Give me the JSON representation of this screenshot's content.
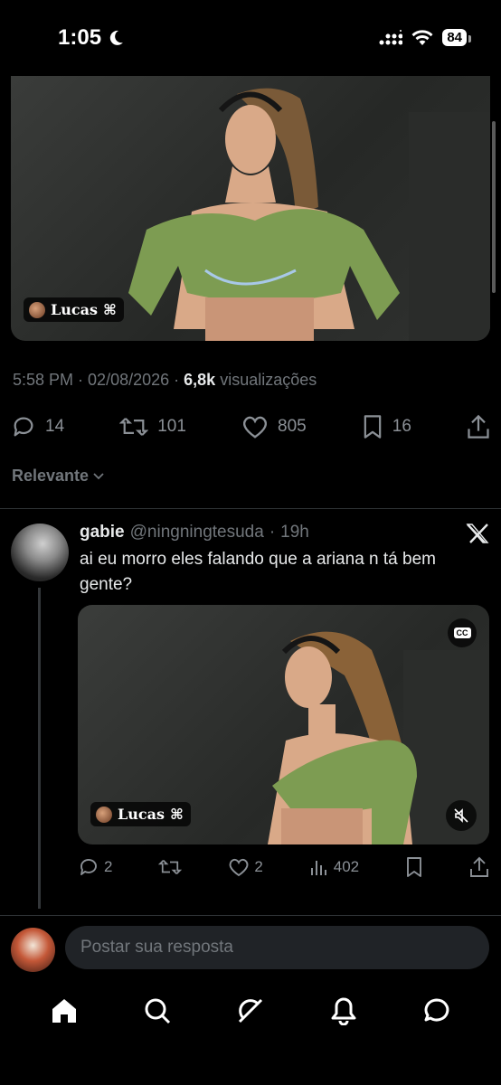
{
  "status_bar": {
    "time": "1:05",
    "battery": "84"
  },
  "post": {
    "media_tag": "Lucas",
    "time": "5:58 PM",
    "date": "02/08/2026",
    "views_count": "6,8k",
    "views_label": "visualizações",
    "replies": "14",
    "reposts": "101",
    "likes": "805",
    "bookmarks": "16"
  },
  "sort": {
    "label": "Relevante"
  },
  "reply": {
    "name": "gabie",
    "handle": "@ningningtesuda",
    "age": "19h",
    "text": "ai eu morro eles falando que a ariana n tá bem gente?",
    "media_tag": "Lucas",
    "cc_label": "CC",
    "replies": "2",
    "likes": "2",
    "views": "402"
  },
  "composer": {
    "placeholder": "Postar sua resposta"
  },
  "colors": {
    "background": "#000000",
    "muted_text": "#71767b",
    "input_bg": "#202327",
    "primary_text": "#e7e9ea"
  },
  "icons": [
    "moon-icon",
    "signal-icon",
    "wifi-icon",
    "reply-icon",
    "repost-icon",
    "like-icon",
    "bookmark-icon",
    "share-icon",
    "chevron-down-icon",
    "x-logo-icon",
    "cc-icon",
    "mute-icon",
    "views-icon",
    "home-icon",
    "search-icon",
    "grok-icon",
    "notifications-icon",
    "messages-icon"
  ]
}
